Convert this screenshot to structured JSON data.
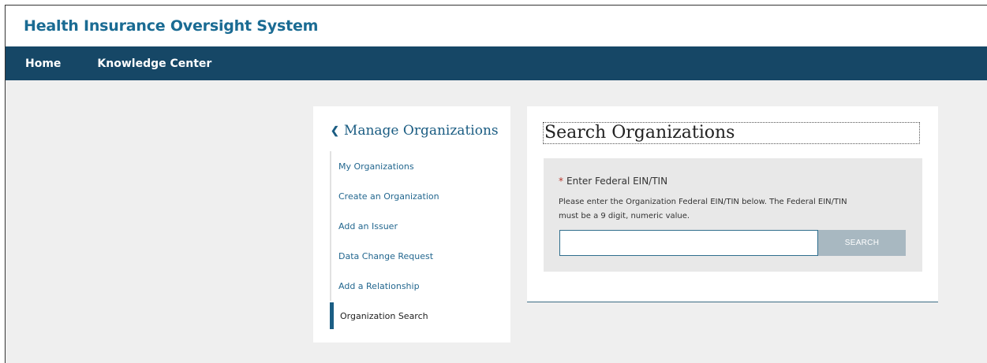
{
  "app": {
    "title": "Health Insurance Oversight System"
  },
  "nav": {
    "items": [
      {
        "label": "Home"
      },
      {
        "label": "Knowledge Center"
      }
    ]
  },
  "sidebar": {
    "heading": "Manage Organizations",
    "back_icon": "chevron-left-icon",
    "items": [
      {
        "label": "My Organizations"
      },
      {
        "label": "Create an Organization"
      },
      {
        "label": "Add an Issuer"
      },
      {
        "label": "Data Change Request"
      },
      {
        "label": "Add a Relationship"
      },
      {
        "label": "Organization Search",
        "active": true
      }
    ]
  },
  "main": {
    "title": "Search Organizations",
    "form": {
      "required_marker": "*",
      "label": "Enter Federal EIN/TIN",
      "help_line1": "Please enter the Organization Federal EIN/TIN below. The Federal EIN/TIN",
      "help_line2": "must be a 9 digit, numeric value.",
      "input_value": "",
      "input_placeholder": "",
      "button_label": "SEARCH"
    }
  },
  "colors": {
    "brand": "#1a6b93",
    "navbar": "#164766",
    "page_bg": "#efefef",
    "button_disabled": "#a8b8c1",
    "required": "#b7372c"
  }
}
